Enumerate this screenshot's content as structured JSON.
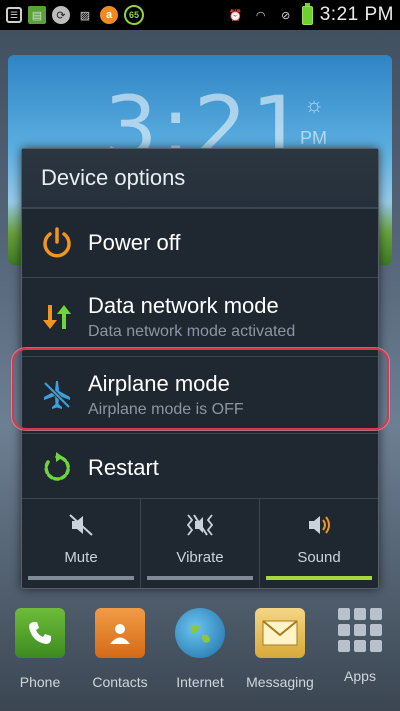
{
  "status_bar": {
    "time": "3:21 PM",
    "notification_badge": "65",
    "colors": {
      "battery": "#6fd12f",
      "badge": "#8fd14f"
    }
  },
  "clock_widget": {
    "time": "3:21",
    "ampm": "PM"
  },
  "dialog": {
    "title": "Device options",
    "options": [
      {
        "label": "Power off",
        "icon": "power-icon"
      },
      {
        "label": "Data network mode",
        "sublabel": "Data network mode activated",
        "icon": "data-network-icon"
      },
      {
        "label": "Airplane mode",
        "sublabel": "Airplane mode is OFF",
        "icon": "airplane-icon"
      },
      {
        "label": "Restart",
        "icon": "restart-icon"
      }
    ],
    "sound_modes": [
      {
        "label": "Mute",
        "icon": "mute-icon",
        "active": false
      },
      {
        "label": "Vibrate",
        "icon": "vibrate-icon",
        "active": false
      },
      {
        "label": "Sound",
        "icon": "sound-icon",
        "active": true
      }
    ],
    "colors": {
      "highlight": "#d9364e",
      "active_indicator": "#a6d83b"
    }
  },
  "dock": {
    "items": [
      {
        "label": "Phone",
        "icon": "phone-icon"
      },
      {
        "label": "Contacts",
        "icon": "contacts-icon"
      },
      {
        "label": "Internet",
        "icon": "internet-icon"
      },
      {
        "label": "Messaging",
        "icon": "messaging-icon"
      },
      {
        "label": "Apps",
        "icon": "apps-icon"
      }
    ]
  }
}
